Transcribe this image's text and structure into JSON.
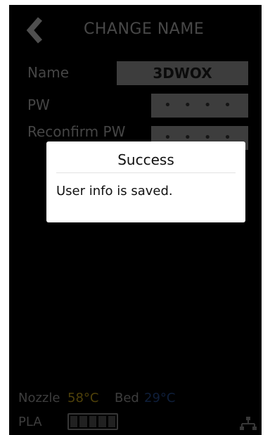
{
  "header": {
    "title": "CHANGE NAME"
  },
  "form": {
    "name_label": "Name",
    "name_value": "3DWOX",
    "pw_label": "PW",
    "pw_value": "• • • •",
    "reconfirm_label": "Reconfirm PW",
    "reconfirm_value": "• • • •"
  },
  "dialog": {
    "title": "Success",
    "message": "User info is saved."
  },
  "status": {
    "nozzle_label": "Nozzle",
    "nozzle_temp": "58°C",
    "bed_label": "Bed",
    "bed_temp": "29°C",
    "filament_label": "PLA",
    "filament_level": 0
  },
  "colors": {
    "nozzle_temp": "#7a6510",
    "bed_temp": "#18305b",
    "background": "#000000"
  },
  "icons": {
    "back": "chevron-left-icon",
    "network": "network-icon",
    "battery": "filament-gauge-icon"
  }
}
